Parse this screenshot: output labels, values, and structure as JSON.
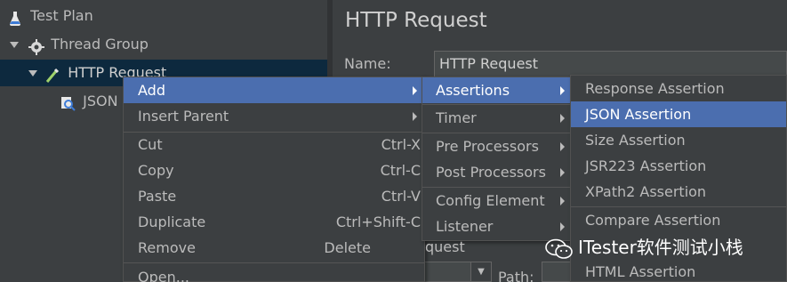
{
  "tree": {
    "items": [
      {
        "label": "Test Plan"
      },
      {
        "label": "Thread Group"
      },
      {
        "label": "HTTP Request"
      },
      {
        "label": "JSON"
      }
    ]
  },
  "panel": {
    "title": "HTTP Request",
    "name_label": "Name:",
    "name_value": "HTTP Request",
    "path_label": "Path:"
  },
  "context_menu": {
    "items": [
      {
        "label": "Add",
        "shortcut": ""
      },
      {
        "label": "Insert Parent",
        "shortcut": ""
      },
      {
        "label": "Cut",
        "shortcut": "Ctrl-X"
      },
      {
        "label": "Copy",
        "shortcut": "Ctrl-C"
      },
      {
        "label": "Paste",
        "shortcut": "Ctrl-V"
      },
      {
        "label": "Duplicate",
        "shortcut": "Ctrl+Shift-C"
      },
      {
        "label": "Remove",
        "shortcut": "Delete"
      },
      {
        "label": "Open...",
        "shortcut": ""
      }
    ]
  },
  "add_menu": {
    "items": [
      {
        "label": "Assertions"
      },
      {
        "label": "Timer"
      },
      {
        "label": "Pre Processors"
      },
      {
        "label": "Post Processors"
      },
      {
        "label": "Config Element"
      },
      {
        "label": "Listener"
      }
    ],
    "overflow_text": "quest"
  },
  "assertions_menu": {
    "items": [
      {
        "label": "Response Assertion"
      },
      {
        "label": "JSON Assertion"
      },
      {
        "label": "Size Assertion"
      },
      {
        "label": "JSR223 Assertion"
      },
      {
        "label": "XPath2 Assertion"
      },
      {
        "label": "Compare Assertion"
      },
      {
        "label": "HTML Assertion"
      }
    ]
  },
  "watermark": {
    "text": "ITester软件测试小栈"
  },
  "colors": {
    "background": "#3c3f41",
    "highlight": "#4b6eaf",
    "tree_selected": "#0d293e",
    "text": "#bbbbbb"
  }
}
